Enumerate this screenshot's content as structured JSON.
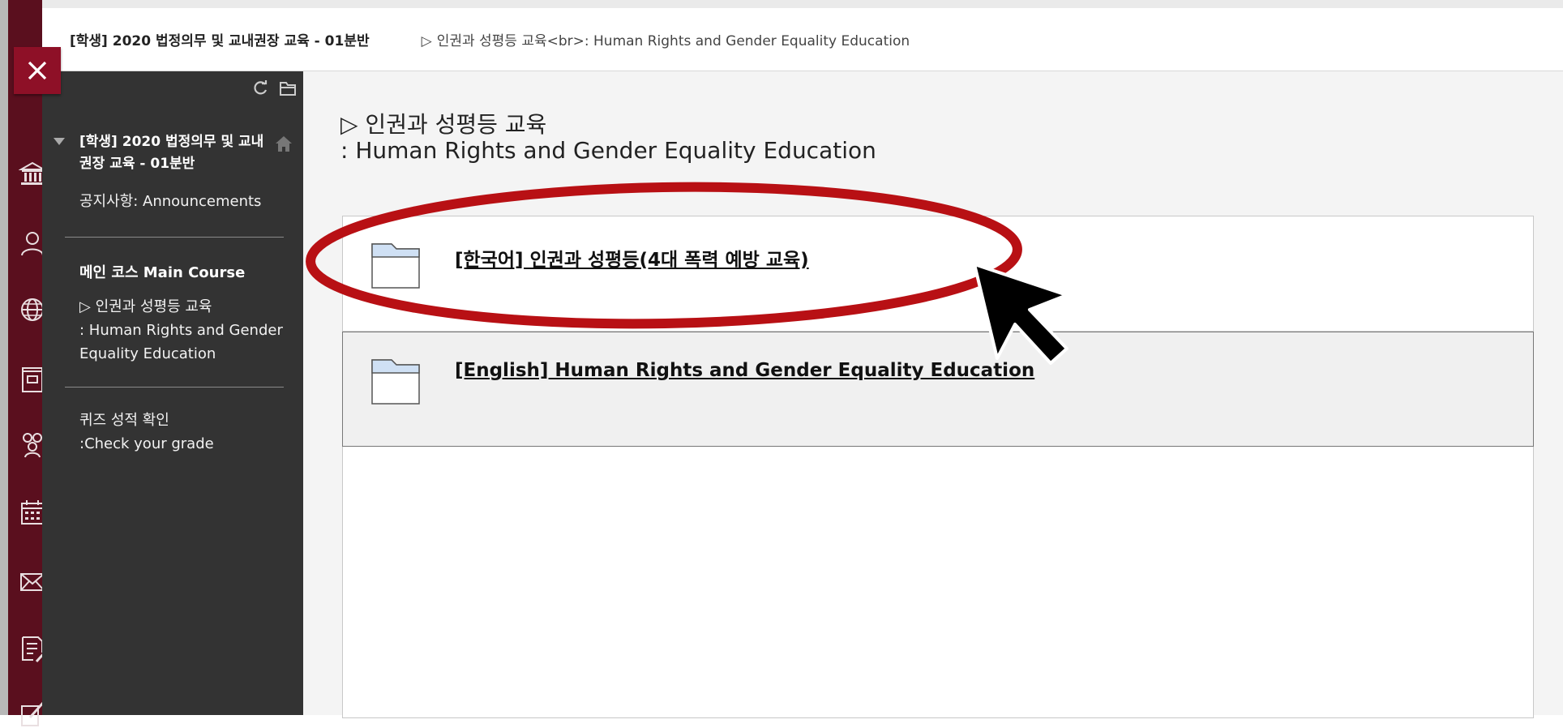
{
  "topbar": {
    "course_crumb": "[학생] 2020 법정의무 및 교내권장 교육 - 01분반",
    "page_crumb": "인권과 성평등 교육<br>: Human Rights and Gender Equality Education",
    "arrow_glyph": "▷"
  },
  "close_button": {
    "icon": "close-icon"
  },
  "rail": {
    "icons": [
      "institution-icon",
      "user-icon",
      "globe-icon",
      "courses-icon",
      "groups-icon",
      "calendar-icon",
      "mail-icon",
      "grades-icon",
      "edit-icon"
    ]
  },
  "course_menu": {
    "tools": [
      "refresh-icon",
      "folder-view-icon"
    ],
    "course_title": "[학생] 2020 법정의무 및 교내권장 교육 - 01분반",
    "announcements": "공지사항: Announcements",
    "main_course_heading": "메인 코스 Main Course",
    "current_item_line1": "▷ 인권과 성평등 교육",
    "current_item_line2": ": Human Rights and Gender Equality Education",
    "grade_item_line1": "퀴즈 성적 확인",
    "grade_item_line2": ":Check your grade"
  },
  "main": {
    "title_line1": "▷ 인권과 성평등 교육",
    "title_line2": ": Human Rights and Gender Equality Education",
    "items": [
      {
        "label": "[한국어] 인권과 성평등(4대 폭력 예방 교육)",
        "icon": "folder-icon"
      },
      {
        "label": "[English] Human Rights and Gender Equality Education",
        "icon": "folder-icon"
      }
    ]
  },
  "colors": {
    "rail": "#5a0f1e",
    "close_button": "#8e1027",
    "course_menu": "#333333",
    "highlight": "#b81014"
  }
}
